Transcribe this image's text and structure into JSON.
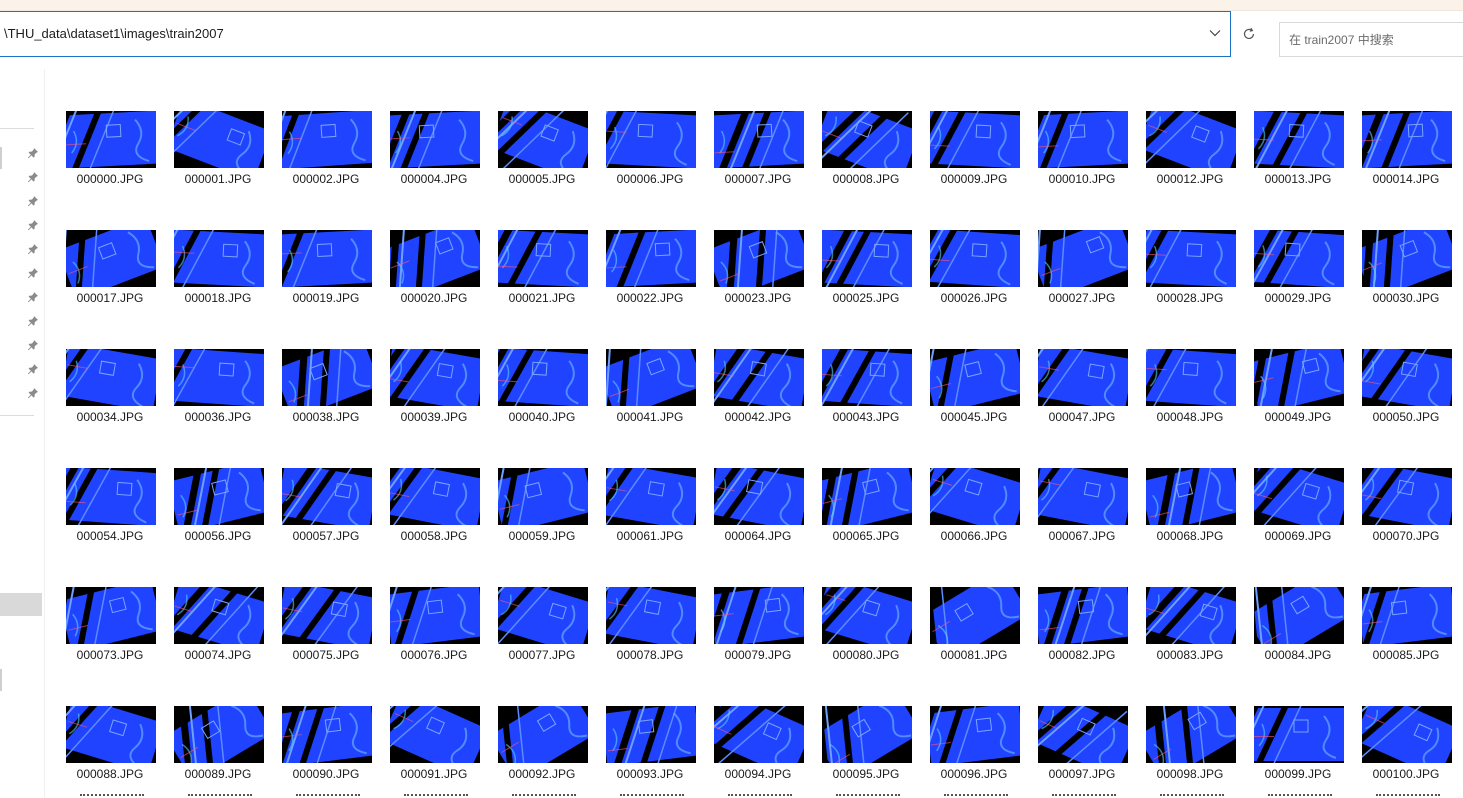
{
  "address": {
    "path": "\\THU_data\\dataset1\\images\\train2007"
  },
  "search": {
    "placeholder": "在 train2007 中搜索"
  },
  "icons": {
    "dropdown": "chevron-down-icon",
    "refresh": "refresh-icon",
    "pin": "pin-icon"
  },
  "colors": {
    "thumbnail_blue": "#1f43ff",
    "address_border": "#1a73c8",
    "selection_gray": "#d9d9d9"
  },
  "files": [
    "000000.JPG",
    "000001.JPG",
    "000002.JPG",
    "000004.JPG",
    "000005.JPG",
    "000006.JPG",
    "000007.JPG",
    "000008.JPG",
    "000009.JPG",
    "000010.JPG",
    "000012.JPG",
    "000013.JPG",
    "000014.JPG",
    "000017.JPG",
    "000018.JPG",
    "000019.JPG",
    "000020.JPG",
    "000021.JPG",
    "000022.JPG",
    "000023.JPG",
    "000025.JPG",
    "000026.JPG",
    "000027.JPG",
    "000028.JPG",
    "000029.JPG",
    "000030.JPG",
    "000034.JPG",
    "000036.JPG",
    "000038.JPG",
    "000039.JPG",
    "000040.JPG",
    "000041.JPG",
    "000042.JPG",
    "000043.JPG",
    "000045.JPG",
    "000047.JPG",
    "000048.JPG",
    "000049.JPG",
    "000050.JPG",
    "000054.JPG",
    "000056.JPG",
    "000057.JPG",
    "000058.JPG",
    "000059.JPG",
    "000061.JPG",
    "000064.JPG",
    "000065.JPG",
    "000066.JPG",
    "000067.JPG",
    "000068.JPG",
    "000069.JPG",
    "000070.JPG",
    "000073.JPG",
    "000074.JPG",
    "000075.JPG",
    "000076.JPG",
    "000077.JPG",
    "000078.JPG",
    "000079.JPG",
    "000080.JPG",
    "000081.JPG",
    "000082.JPG",
    "000083.JPG",
    "000084.JPG",
    "000085.JPG",
    "000088.JPG",
    "000089.JPG",
    "000090.JPG",
    "000091.JPG",
    "000092.JPG",
    "000093.JPG",
    "000094.JPG",
    "000095.JPG",
    "000096.JPG",
    "000097.JPG",
    "000098.JPG",
    "000099.JPG",
    "000100.JPG"
  ]
}
